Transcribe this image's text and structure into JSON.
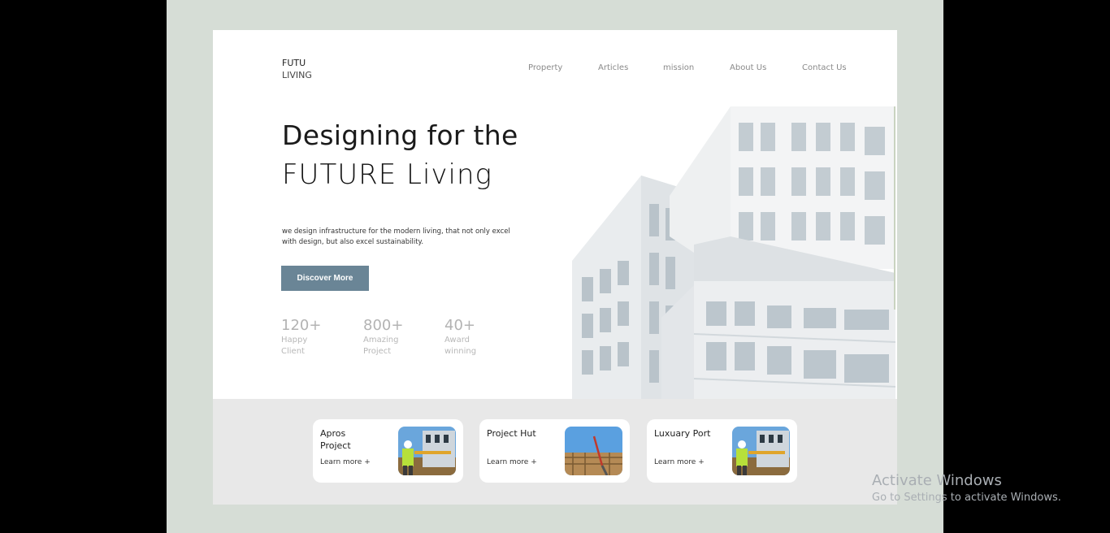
{
  "brand": {
    "line1": "FUTU",
    "line2": "LIVING"
  },
  "nav": [
    "Property",
    "Articles",
    "mission",
    "About Us",
    "Contact Us"
  ],
  "hero": {
    "title_line1": "Designing for the",
    "title_line2": "FUTURE Living",
    "description": "we design infrastructure for the modern living, that not only excel with design, but also excel sustainability.",
    "cta_label": "Discover More"
  },
  "stats": [
    {
      "value": "120+",
      "label": "Happy Client"
    },
    {
      "value": "800+",
      "label": "Amazing Project"
    },
    {
      "value": "40+",
      "label": "Award winning"
    }
  ],
  "cards": [
    {
      "title": "Apros Project",
      "link": "Learn more +",
      "image": "worker-photo"
    },
    {
      "title": "Project Hut",
      "link": "Learn more +",
      "image": "construction-crane-photo"
    },
    {
      "title": "Luxuary Port",
      "link": "Learn more +",
      "image": "worker-photo"
    }
  ],
  "os_watermark": {
    "title": "Activate Windows",
    "subtitle": "Go to Settings to activate Windows."
  },
  "colors": {
    "stage_bg": "#d6ddd6",
    "button": "#6a8596",
    "bottom_band": "#e8e8e8"
  }
}
